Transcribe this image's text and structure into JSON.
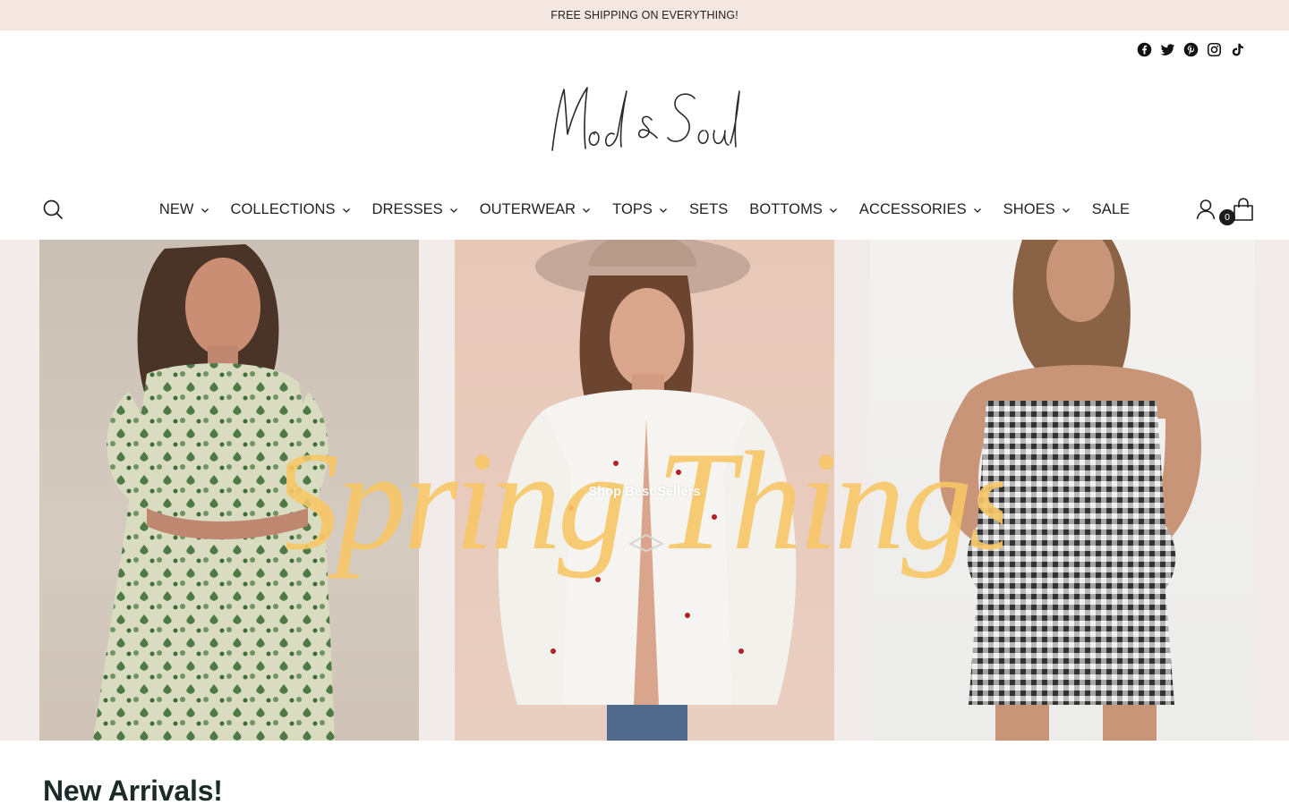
{
  "announcement": {
    "text": "FREE SHIPPING ON EVERYTHING!"
  },
  "social": [
    {
      "name": "facebook-icon"
    },
    {
      "name": "twitter-icon"
    },
    {
      "name": "pinterest-icon"
    },
    {
      "name": "instagram-icon"
    },
    {
      "name": "tiktok-icon"
    }
  ],
  "brand": {
    "logo_text": "Mod & Soul"
  },
  "nav": {
    "items": [
      {
        "label": "NEW",
        "dropdown": true
      },
      {
        "label": "COLLECTIONS",
        "dropdown": true
      },
      {
        "label": "DRESSES",
        "dropdown": true
      },
      {
        "label": "OUTERWEAR",
        "dropdown": true
      },
      {
        "label": "TOPS",
        "dropdown": true
      },
      {
        "label": "SETS",
        "dropdown": false
      },
      {
        "label": "BOTTOMS",
        "dropdown": true
      },
      {
        "label": "ACCESSORIES",
        "dropdown": true
      },
      {
        "label": "SHOES",
        "dropdown": true
      },
      {
        "label": "SALE",
        "dropdown": false
      }
    ]
  },
  "header_icons": {
    "search": "search-icon",
    "account": "account-icon",
    "cart": "bag-icon"
  },
  "cart": {
    "count": "0"
  },
  "hero": {
    "script_text": "Spring Things",
    "cta": "Shop Best Sellers",
    "colors": {
      "script": "#f7c766",
      "background": "#efe9e5"
    }
  },
  "sections": {
    "new_arrivals_title": "New Arrivals!"
  },
  "colors": {
    "announcement_bg": "#f4e7e1",
    "text": "#1f1f1f",
    "badge": "#1c1c1c"
  }
}
